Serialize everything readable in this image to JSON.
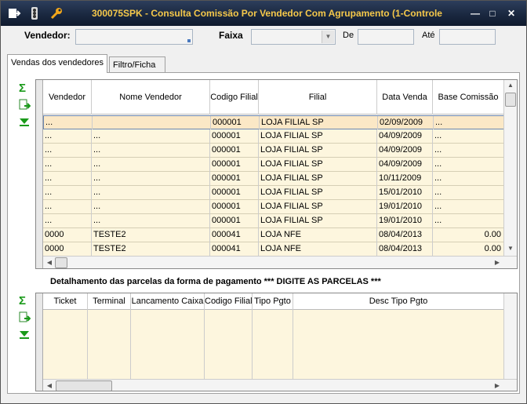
{
  "window": {
    "title": "300075SPK - Consulta Comissão Por Vendedor Com Agrupamento (1-Controle"
  },
  "filters": {
    "vendedor_label": "Vendedor:",
    "faixa_label": "Faixa",
    "de_label": "De",
    "ate_label": "Até"
  },
  "tabs": [
    {
      "label": "Vendas dos vendedores",
      "active": true
    },
    {
      "label": "Filtro/Ficha",
      "active": false
    }
  ],
  "sales_grid": {
    "columns": [
      "Vendedor",
      "Nome Vendedor",
      "Codigo Filial",
      "Filial",
      "Data Venda",
      "Base Comissão"
    ],
    "rows": [
      [
        "...",
        "",
        "000001",
        "LOJA FILIAL SP",
        "02/09/2009",
        "..."
      ],
      [
        "...",
        "...",
        "000001",
        "LOJA FILIAL SP",
        "04/09/2009",
        "..."
      ],
      [
        "...",
        "...",
        "000001",
        "LOJA FILIAL SP",
        "04/09/2009",
        "..."
      ],
      [
        "...",
        "...",
        "000001",
        "LOJA FILIAL SP",
        "04/09/2009",
        "..."
      ],
      [
        "...",
        "...",
        "000001",
        "LOJA FILIAL SP",
        "10/11/2009",
        "..."
      ],
      [
        "...",
        "...",
        "000001",
        "LOJA FILIAL SP",
        "15/01/2010",
        "..."
      ],
      [
        "...",
        "...",
        "000001",
        "LOJA FILIAL SP",
        "19/01/2010",
        "..."
      ],
      [
        "...",
        "...",
        "000001",
        "LOJA FILIAL SP",
        "19/01/2010",
        "..."
      ],
      [
        "0000",
        "TESTE2",
        "000041",
        "LOJA NFE",
        "08/04/2013",
        "0.00"
      ],
      [
        "0000",
        "TESTE2",
        "000041",
        "LOJA NFE",
        "08/04/2013",
        "0.00"
      ]
    ]
  },
  "detail": {
    "title": "Detalhamento das parcelas da forma de pagamento *** DIGITE AS PARCELAS ***",
    "columns": [
      "Ticket",
      "Terminal",
      "Lancamento Caixa",
      "Codigo Filial",
      "Tipo Pgto",
      "Desc Tipo Pgto"
    ]
  },
  "colors": {
    "title_bg": "#1a2840",
    "title_text": "#f5c84a",
    "row_bg": "#fdf6de",
    "selected_row": "#fbe8c6"
  }
}
